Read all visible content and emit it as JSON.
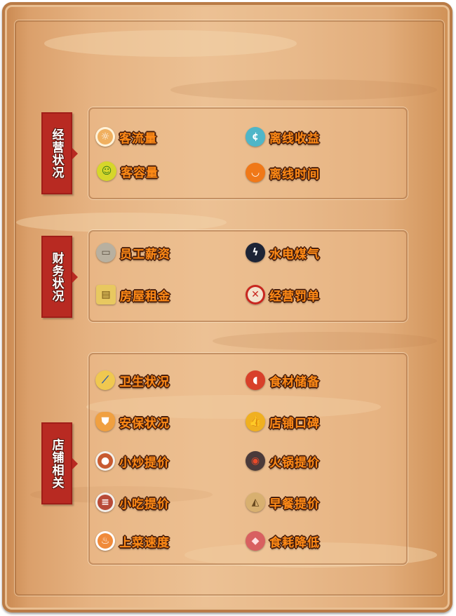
{
  "sections": [
    {
      "tag": "经营状况",
      "items": [
        {
          "label": "客流量",
          "icon": "footprint-icon",
          "color": "#f0b060"
        },
        {
          "label": "离线收益",
          "icon": "coin-hand-icon",
          "color": "#4fb6c8"
        },
        {
          "label": "客容量",
          "icon": "people-icon",
          "color": "#d6d62a"
        },
        {
          "label": "离线时间",
          "icon": "bowl-clock-icon",
          "color": "#f07818"
        }
      ]
    },
    {
      "tag": "财务状况",
      "items": [
        {
          "label": "员工薪资",
          "icon": "banknote-icon",
          "color": "#b8b0a0"
        },
        {
          "label": "水电煤气",
          "icon": "lightning-icon",
          "color": "#1d2436"
        },
        {
          "label": "房屋租金",
          "icon": "rent-sign-icon",
          "color": "#e8c860"
        },
        {
          "label": "经营罚单",
          "icon": "fine-stamp-icon",
          "color": "#c8261e"
        }
      ]
    },
    {
      "tag": "店铺相关",
      "items": [
        {
          "label": "卫生状况",
          "icon": "broom-icon",
          "color": "#5a8fd8"
        },
        {
          "label": "食材储备",
          "icon": "meat-icon",
          "color": "#d8402a"
        },
        {
          "label": "安保状况",
          "icon": "shield-icon",
          "color": "#f0a040"
        },
        {
          "label": "店铺口碑",
          "icon": "thumbs-up-icon",
          "color": "#f0b020"
        },
        {
          "label": "小炒提价",
          "icon": "stirfry-dish-icon",
          "color": "#c85a30"
        },
        {
          "label": "火锅提价",
          "icon": "hotpot-icon",
          "color": "#4a3a3a"
        },
        {
          "label": "小吃提价",
          "icon": "snack-plate-icon",
          "color": "#b84a38"
        },
        {
          "label": "早餐提价",
          "icon": "breakfast-icon",
          "color": "#d8b070"
        },
        {
          "label": "上菜速度",
          "icon": "chef-icon",
          "color": "#f08a3a"
        },
        {
          "label": "食耗降低",
          "icon": "ingredients-icon",
          "color": "#d86060"
        }
      ]
    }
  ]
}
